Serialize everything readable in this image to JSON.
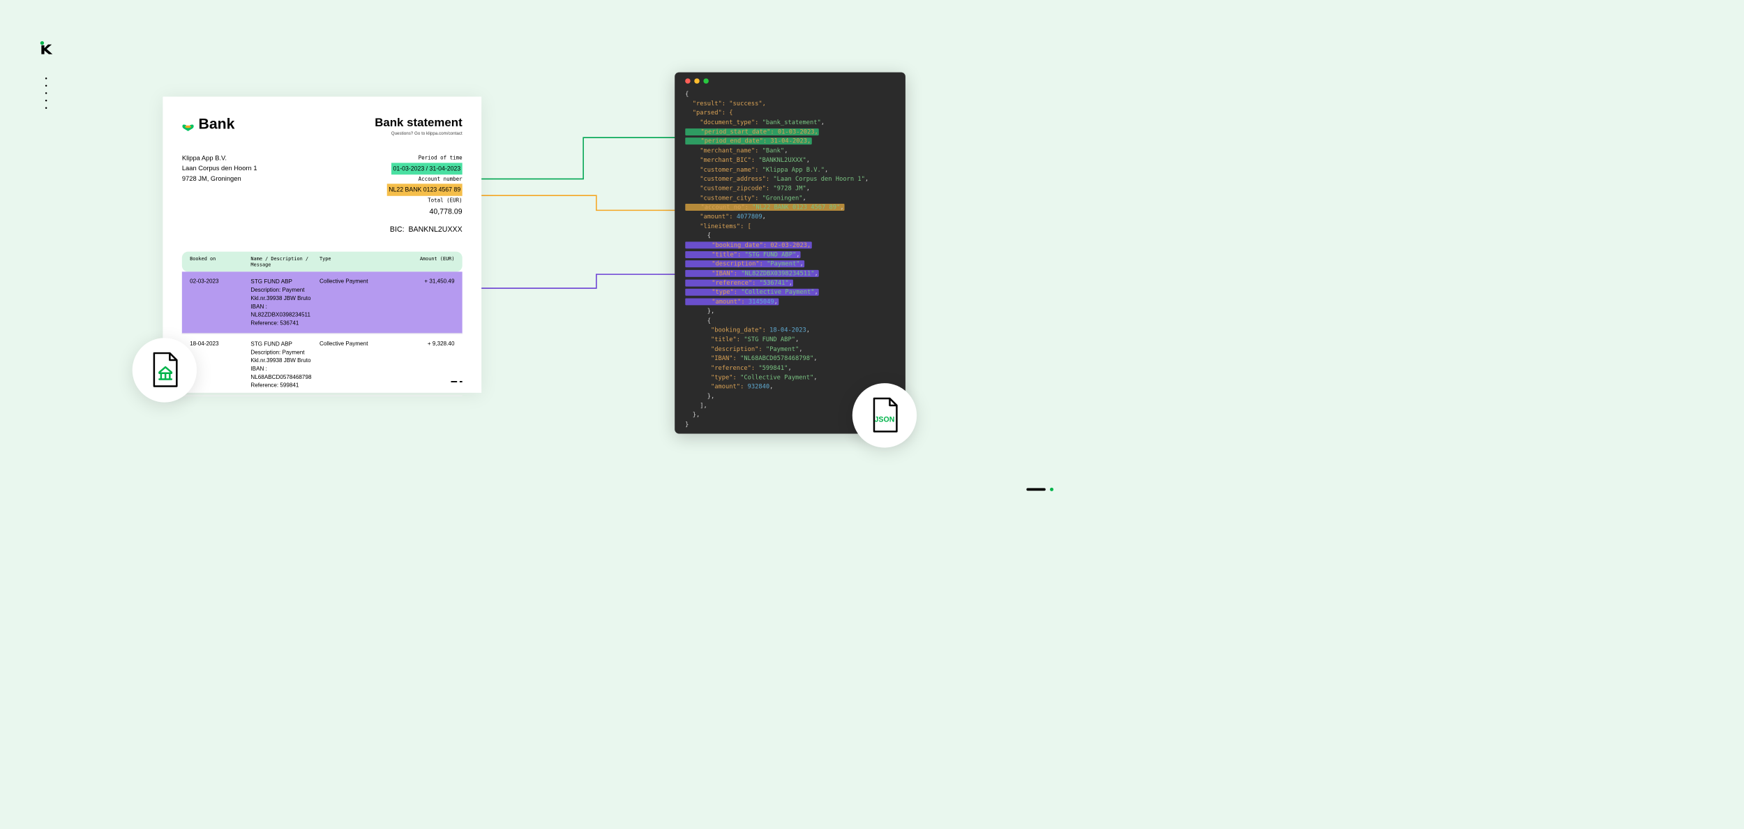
{
  "logo_glyph": "k",
  "statement": {
    "bank_name": "Bank",
    "title": "Bank statement",
    "subtitle": "Questions? Go to klippa.com/contact",
    "customer": {
      "name": "Klippa App B.V.",
      "address": "Laan Corpus den Hoorn 1",
      "city": "9728 JM, Groningen"
    },
    "meta": {
      "period_label": "Period of time",
      "period_value": "01-03-2023 / 31-04-2023",
      "account_label": "Account number",
      "account_value": "NL22 BANK 0123 4567 89",
      "total_label": "Total (EUR)",
      "total_value": "40,778.09",
      "bic_label": "BIC:",
      "bic_value": "BANKNL2UXXX"
    },
    "columns": {
      "c1": "Booked on",
      "c2": "Name / Description / Message",
      "c3": "Type",
      "c4": "Amount (EUR)"
    },
    "rows": [
      {
        "date": "02-03-2023",
        "l1": "STG FUND ABP",
        "l2": "Description: Payment",
        "l3": "Kkl.nr.39938 JBW Bruto",
        "l4": "IBAN : NL82ZDBX0398234511",
        "l5": "Reference: 536741",
        "type": "Collective Payment",
        "amount": "+ 31,450.49"
      },
      {
        "date": "18-04-2023",
        "l1": "STG FUND ABP",
        "l2": "Description: Payment",
        "l3": "Kkl.nr.39938 JBW Bruto",
        "l4": "IBAN : NL68ABCD0578468798",
        "l5": "Reference: 599841",
        "type": "Collective Payment",
        "amount": "+ 9,328.40"
      }
    ]
  },
  "json_output": {
    "t01": "{",
    "t02": "  \"result\": \"success\",",
    "t03": "  \"parsed\": {",
    "t04a": "    \"document_type\": ",
    "t04b": "\"bank_statement\"",
    "t04c": ",",
    "t05a": "    \"period_start_date\": 01-03-2023,",
    "t06a": "    \"period_end_date\": 31-04-2023,",
    "t07a": "    \"merchant_name\": ",
    "t07b": "\"Bank\"",
    "t07c": ",",
    "t08a": "    \"merchant_BIC\": ",
    "t08b": "\"BANKNL2UXXX\"",
    "t08c": ",",
    "t09a": "    \"customer_name\": ",
    "t09b": "\"Klippa App B.V.\"",
    "t09c": ",",
    "t10a": "    \"customer_address\": ",
    "t10b": "\"Laan Corpus den Hoorn 1\"",
    "t10c": ",",
    "t11a": "    \"customer_zipcode\": ",
    "t11b": "\"9728 JM\"",
    "t11c": ",",
    "t12a": "    \"customer_city\": ",
    "t12b": "\"Groningen\"",
    "t12c": ",",
    "t13a": "    \"account_no\": ",
    "t13b": "\"NL22 BANK 0123 4567 89\"",
    "t13c": ",",
    "t14a": "    \"amount\": ",
    "t14b": "4077809",
    "t14c": ",",
    "t15": "    \"lineitems\": [",
    "t16": "      {",
    "t17a": "       \"booking_date\": 02-03-2023,",
    "t18a": "       \"title\": ",
    "t18b": "\"STG FUND ABP\"",
    "t18c": ",",
    "t19a": "       \"description\": ",
    "t19b": "\"Payment\"",
    "t19c": ",",
    "t20a": "       \"IBAN\": ",
    "t20b": "\"NL82ZDBX0398234511\"",
    "t20c": ",",
    "t21a": "       \"reference\": ",
    "t21b": "\"536741\"",
    "t21c": ",",
    "t22a": "       \"type\": ",
    "t22b": "\"Collective Payment\"",
    "t22c": ",",
    "t23a": "       \"amount\": ",
    "t23b": "3145049",
    "t23c": ",",
    "t24": "      },",
    "t25": "      {",
    "t26a": "       \"booking_date\": ",
    "t26b": "18-04-2023",
    "t26c": ",",
    "t27a": "       \"title\": ",
    "t27b": "\"STG FUND ABP\"",
    "t27c": ",",
    "t28a": "       \"description\": ",
    "t28b": "\"Payment\"",
    "t28c": ",",
    "t29a": "       \"IBAN\": ",
    "t29b": "\"NL68ABCD0578468798\"",
    "t29c": ",",
    "t30a": "       \"reference\": ",
    "t30b": "\"599841\"",
    "t30c": ",",
    "t31a": "       \"type\": ",
    "t31b": "\"Collective Payment\"",
    "t31c": ",",
    "t32a": "       \"amount\": ",
    "t32b": "932840",
    "t32c": ",",
    "t33": "      },",
    "t34": "    ],",
    "t35": "  },",
    "t36": "}"
  },
  "badges": {
    "json_label": "JSON"
  }
}
